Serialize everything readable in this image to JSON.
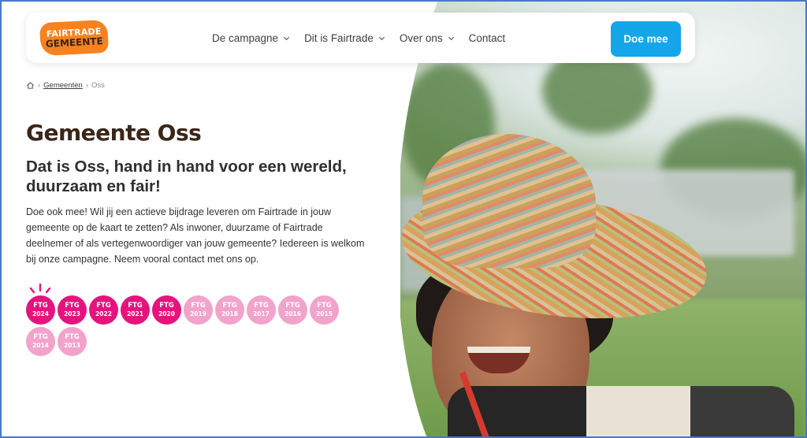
{
  "header": {
    "logo": {
      "line1": "FAIRTRADE",
      "line2": "GEMEENTE"
    },
    "nav": [
      {
        "label": "De campagne",
        "has_dropdown": true
      },
      {
        "label": "Dit is Fairtrade",
        "has_dropdown": true
      },
      {
        "label": "Over ons",
        "has_dropdown": true
      },
      {
        "label": "Contact",
        "has_dropdown": false
      }
    ],
    "cta_label": "Doe mee"
  },
  "breadcrumb": {
    "home_icon": "home-icon",
    "items": [
      "Gemeenten",
      "Oss"
    ],
    "separator": "›"
  },
  "main": {
    "title": "Gemeente Oss",
    "subtitle": "Dat is Oss, hand in hand voor een wereld, duurzaam en fair!",
    "body": "Doe ook mee! Wil jij een actieve bijdrage leveren om Fairtrade in jouw gemeente op de kaart te zetten? Als inwoner, duurzame of Fairtrade deelnemer of als vertegenwoordiger van jouw gemeente? Iedereen is welkom bij onze campagne. Neem vooral contact met ons op."
  },
  "badges": [
    {
      "label": "FTG",
      "year": "2024",
      "active": true
    },
    {
      "label": "FTG",
      "year": "2023",
      "active": true
    },
    {
      "label": "FTG",
      "year": "2022",
      "active": true
    },
    {
      "label": "FTG",
      "year": "2021",
      "active": true
    },
    {
      "label": "FTG",
      "year": "2020",
      "active": true
    },
    {
      "label": "FTG",
      "year": "2019",
      "active": false
    },
    {
      "label": "FTG",
      "year": "2018",
      "active": false
    },
    {
      "label": "FTG",
      "year": "2017",
      "active": false
    },
    {
      "label": "FTG",
      "year": "2016",
      "active": false
    },
    {
      "label": "FTG",
      "year": "2015",
      "active": false
    },
    {
      "label": "FTG",
      "year": "2014",
      "active": false
    },
    {
      "label": "FTG",
      "year": "2013",
      "active": false
    }
  ],
  "colors": {
    "logo_orange": "#f6831f",
    "cta_blue": "#14a6e8",
    "badge_active": "#e6137d",
    "badge_inactive": "#f2a3cb",
    "title_brown": "#3a2618"
  }
}
